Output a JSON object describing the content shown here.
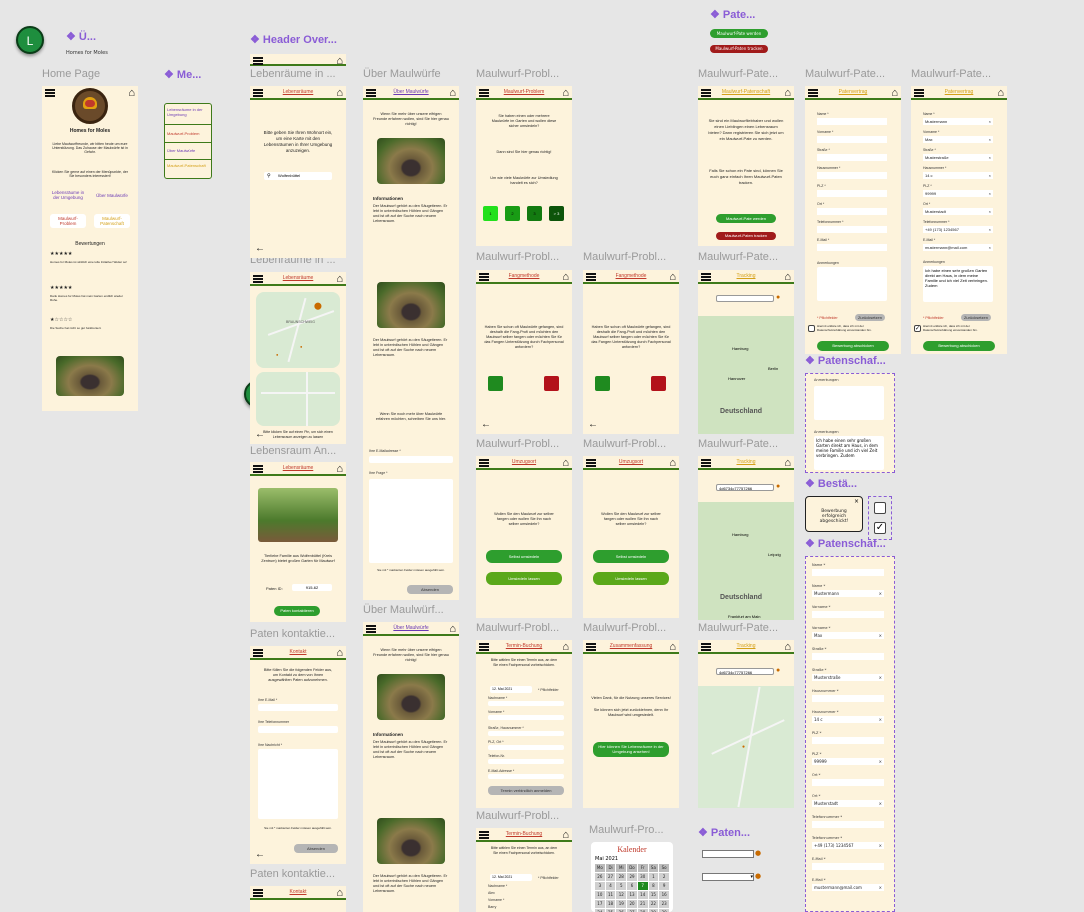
{
  "badges": {
    "top": "L",
    "mid": "D"
  },
  "components": {
    "u": "❖ Ü...",
    "me": "❖ Me...",
    "header": "❖ Header Over...",
    "pate": "❖ Pate...",
    "patenschaf1": "❖ Patenschaf...",
    "besta": "❖ Bestä...",
    "patenschaf2": "❖ Patenschaf...",
    "paten": "❖ Paten..."
  },
  "u_sub": "Homes for Moles",
  "frame_labels": {
    "home": "Home Page",
    "lebensraume": "Lebenräume in ...",
    "lebensraume2": "Lebenräume in ...",
    "lebensraum_an": "Lebensraum An...",
    "paten_kontakt": "Paten kontaktie...",
    "paten_kontakt2": "Paten kontaktie...",
    "uber": "Über Maulwürfe",
    "uber2": "Über Maulwürf...",
    "mp1": "Maulwurf-Probl...",
    "mp2": "Maulwurf-Probl...",
    "mp3": "Maulwurf-Probl...",
    "mp4": "Maulwurf-Probl...",
    "mp5": "Maulwurf-Probl...",
    "mp6": "Maulwurf-Probl...",
    "mp7": "Maulwurf-Probl...",
    "mp8": "Maulwurf-Pro...",
    "mpa1": "Maulwurf-Pate...",
    "mpa2": "Maulwurf-Pate...",
    "mpa3": "Maulwurf-Pate...",
    "mpa4": "Maulwurf-Pate...",
    "mpa5": "Maulwurf-Pate...",
    "mpa6": "Maulwurf-Pate..."
  },
  "pate_buttons": {
    "werden": "Maulwurf-Pate werden",
    "tracken": "Maulwurf-Paten tracken"
  },
  "home": {
    "brand": "Homes for Moles",
    "intro": "Liebe Maulwurffreunde, wir bitten heute um eure Unterstützung. Das Zuhause der Maulwürfe ist in Gefahr.",
    "intro2": "Klicken Sie gerne auf einen der Menüpunkte, der Sie besonders interessiert!",
    "lebensraum": "Lebensräume in der Umgebung",
    "uber": "Über Maulwürfe",
    "problem": "Maulwurf-Problem",
    "pate": "Maulwurf-Patenschaft",
    "reviews_title": "Bewertungen",
    "rev1": "Homes for Moles ist wirklich eine tolle Initiative! Weiter so!",
    "rev2": "Dank Homes for Moles hat mein Garten endlich wieder Ruhe.",
    "rev3": "Die Suche hat nicht so gut funktioniert."
  },
  "menu": {
    "a": "Lebensräume in der Umgebung",
    "b": "Maulwurf-Problem",
    "c": "Über Maulwürfe",
    "d": "Maulwurf-Patenschaft"
  },
  "titles": {
    "lebensraume": "Lebensräume",
    "uber": "Über Maulwürfe",
    "problem": "Maulwurf-Problem",
    "fangmethode": "Fangmethode",
    "umzugsort": "Umzugsort",
    "termin": "Termin-Buchung",
    "zusammen": "Zusammenfassung",
    "patenschaft": "Maulwurf-Patenschaft",
    "patenvertrag": "Patenvertrag",
    "tracking": "Tracking",
    "kontakt": "Kontakt",
    "kalender": "Kalender",
    "kal_month": "Mai 2021"
  },
  "lr": {
    "text": "Bitte geben Sie Ihren Wohnort ein, um eine Karte mit den Lebensräumen in Ihrer Umgebung anzuzeigen.",
    "search": "Wolfenbüttel",
    "map_label": "BRAUNSCHWEIG",
    "hint": "Bitte klicken Sie auf einen Pin, um sich einen Lebensraum anzeigen zu lassen"
  },
  "lra": {
    "text": "Tierliebe Familie aus Wolfenbüttel (Kreis Zentrum) bietet großen Garten für Maulwurf",
    "code_label": "Paten ID:",
    "code": "915-62",
    "btn": "Paten kontaktieren"
  },
  "uber": {
    "intro": "Wenn Sie mehr über unsere eifrigen Freunde erfahren wollen, sind Sie hier genau richtig!",
    "info_title": "Informationen",
    "info": "Der Maulwurf gehört zu den Säugetieren. Er lebt in unterirdischen Höhlen und Gängen und ist oft auf der Suche nach neuem Lebensraum.",
    "footer": "Wenn Sie noch mehr über Maulwürfe erfahren möchten, schreiben Sie uns hier.",
    "email": "Ihre E-Mailadresse *",
    "frage": "Ihre Frage *",
    "req": "Sie mit * markierten Felder müssen ausgefüllt sein.",
    "send": "Absenden"
  },
  "problem": {
    "text": "Sie haben einen oder mehrere Maulwürfe im Garten und wollen diese sicher umsiedeln?",
    "q": "Dann sind Sie hier genau richtig!",
    "q2": "Um wie viele Maulwürfe zur Umsiedlung handelt es sich?",
    "opts": [
      "1",
      "2",
      "3",
      "> 3"
    ]
  },
  "fang": {
    "text": "Haben Sie schon oft Maulwürfe gefangen, sind deshalb die Fang-Profi und möchten den Maulwurf selber fangen oder möchten Sie für das Fangen Unterstützung durch Fachpersonal anfordern?"
  },
  "umzug": {
    "text": "Wollen Sie den Maulwurf zur selber fangen oder wollen Sie ihn nach selber umsiedeln?",
    "b1": "Selbst umsiedeln",
    "b2": "Umsiedeln lassen"
  },
  "termin": {
    "text": "Bitte wählen Sie einen Termin aus, an dem Sie einen Fachpersonal vorbeischicken.",
    "date": "12. Mai 2021",
    "wahl": "* Pflichtfelder",
    "fields": [
      "Nachname *",
      "Vorname *",
      "Straße, Hausnummer *",
      "PLZ, Ort *",
      "Telefon-Nr.",
      "E-Mail-Adresse *"
    ],
    "btn": "Termin verbindlich anmelden",
    "names": [
      "Nachname *",
      "Alex",
      "Vorname *",
      "Barry"
    ]
  },
  "zus": {
    "a": "Vielen Dank, für die Nutzung unseres Services!",
    "b": "Sie können sich jetzt zurücklehnen, denn Ihr Maulwurf wird umgesiedelt.",
    "btn": "Hier können Sie Lebensräume in der Umgebung ansehen!"
  },
  "pat": {
    "text": "Sie sind ein Maulwurfliebhaber und wollen einen Lieblingen einen Lebensraum bieten? Dann registrieren Sie sich jetzt um ein Maulwurf-Pate zu werden.",
    "text2": "Falls Sie schon ein Pate sind, können Sie euch ganz einfach Ihren Maulwurf-Paten tracken."
  },
  "vertrag": {
    "fields": [
      "Name *",
      "Vorname *",
      "Straße *",
      "Hausnummer *",
      "PLZ *",
      "Ort *",
      "Telefonnummer *",
      "E-Mail *",
      "Anmerkungen"
    ],
    "filled": [
      "Mustermann",
      "Max",
      "Musterstraße",
      "14 c",
      "99999",
      "Musterstadt",
      "+49 (173) 1234567",
      "mustermann@mail.com"
    ],
    "anm": "Ich habe einen sehr großen Garten direkt am Haus, in dem meine Familie und ich viel Zeit verbringen. Zudem",
    "req": "* Pflichtfelder",
    "zur": "Zurücksetzen",
    "check": "Hiermit erkläre ich, dass ich mit der Datenschutzerklärung einverstanden bin.",
    "btn": "Bewerbung abschicken"
  },
  "track": {
    "id": "4d6734c77757266",
    "de": "Deutschland",
    "cities": [
      "Hamburg",
      "Berlin",
      "Hannover",
      "Frankfurt am Main",
      "Leipzig"
    ]
  },
  "besta": {
    "text": "Bewerbung erfolgreich abgeschickt!"
  },
  "kontakt": {
    "text": "Bitte füllen Sie die folgenden Felder aus, um Kontakt zu dem von Ihnen ausgewählten Paten aufzunehmen.",
    "email": "Ihre E-Mail *",
    "tel": "Ihre Telefonnummer",
    "msg": "Ihre Nachricht *",
    "req": "Sie mit * markierten Felder müssen ausgefüllt sein.",
    "send": "Absenden"
  },
  "calendar": {
    "days": [
      "Mo",
      "Di",
      "Mi",
      "Do",
      "Fr",
      "Sa",
      "So"
    ],
    "nums": [
      "26",
      "27",
      "28",
      "29",
      "30",
      "1",
      "2",
      "3",
      "4",
      "5",
      "6",
      "7",
      "8",
      "9",
      "10",
      "11",
      "12",
      "13",
      "14",
      "15",
      "16",
      "17",
      "18",
      "19",
      "20",
      "21",
      "22",
      "23",
      "24",
      "25",
      "26",
      "27",
      "28",
      "29",
      "30"
    ]
  }
}
